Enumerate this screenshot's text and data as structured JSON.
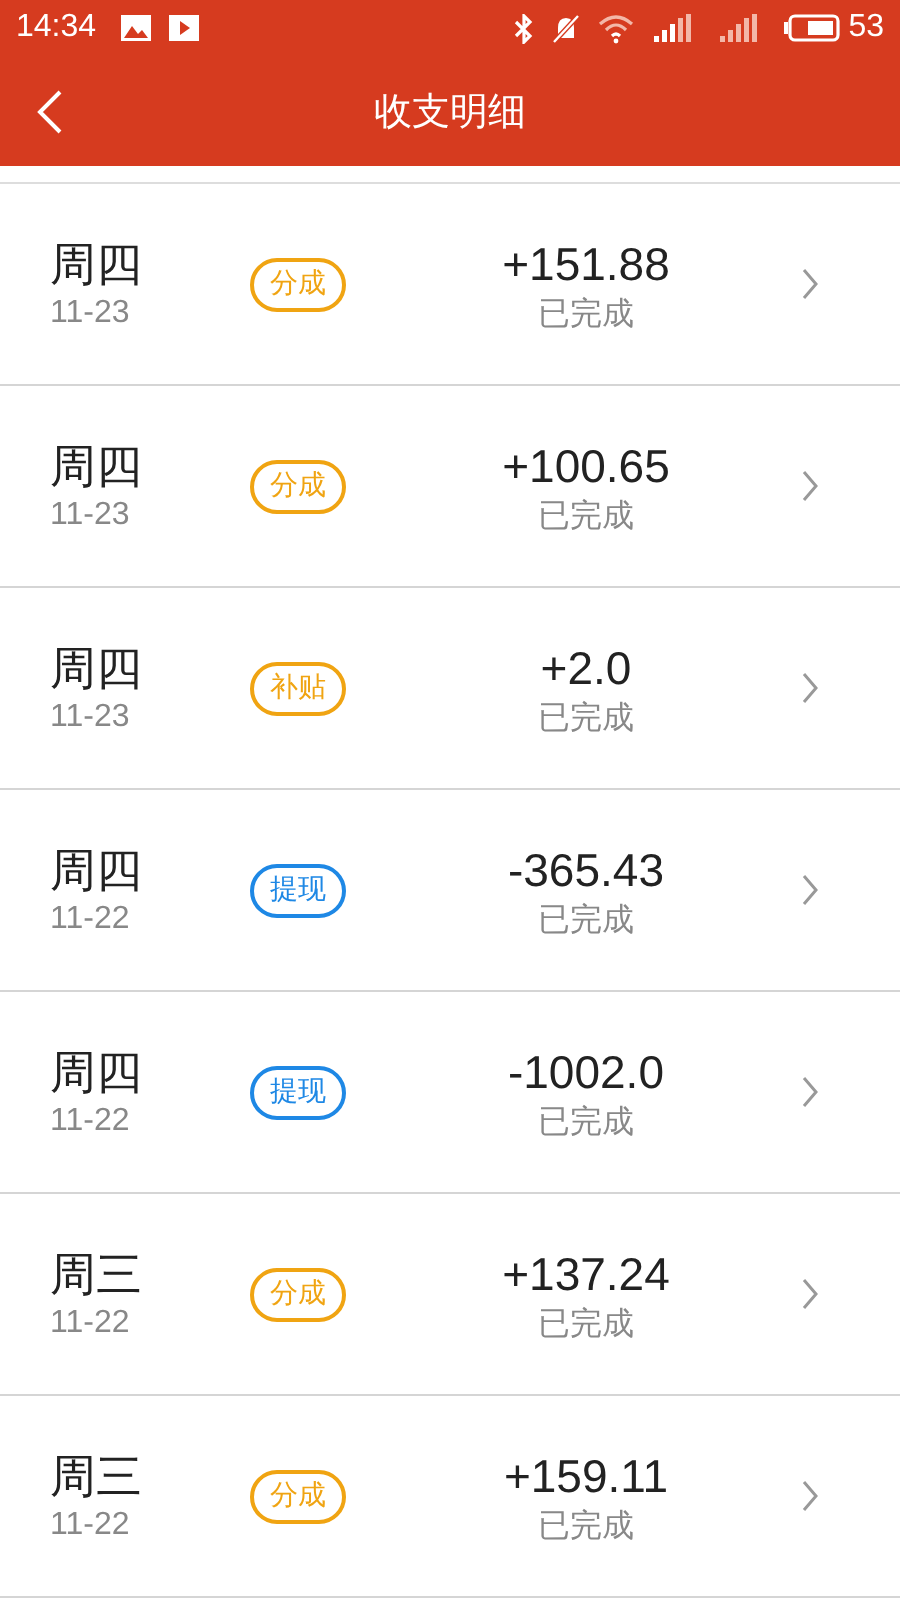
{
  "status_bar": {
    "time": "14:34",
    "battery": "53"
  },
  "header": {
    "title": "收支明细"
  },
  "records": [
    {
      "weekday": "周四",
      "date": "11-23",
      "tag": {
        "label": "分成",
        "color": "#f0a412"
      },
      "amount": "+151.88",
      "status": "已完成"
    },
    {
      "weekday": "周四",
      "date": "11-23",
      "tag": {
        "label": "分成",
        "color": "#f0a412"
      },
      "amount": "+100.65",
      "status": "已完成"
    },
    {
      "weekday": "周四",
      "date": "11-23",
      "tag": {
        "label": "补贴",
        "color": "#f0a412"
      },
      "amount": "+2.0",
      "status": "已完成"
    },
    {
      "weekday": "周四",
      "date": "11-22",
      "tag": {
        "label": "提现",
        "color": "#1e88e5"
      },
      "amount": "-365.43",
      "status": "已完成"
    },
    {
      "weekday": "周四",
      "date": "11-22",
      "tag": {
        "label": "提现",
        "color": "#1e88e5"
      },
      "amount": "-1002.0",
      "status": "已完成"
    },
    {
      "weekday": "周三",
      "date": "11-22",
      "tag": {
        "label": "分成",
        "color": "#f0a412"
      },
      "amount": "+137.24",
      "status": "已完成"
    },
    {
      "weekday": "周三",
      "date": "11-22",
      "tag": {
        "label": "分成",
        "color": "#f0a412"
      },
      "amount": "+159.11",
      "status": "已完成"
    }
  ]
}
